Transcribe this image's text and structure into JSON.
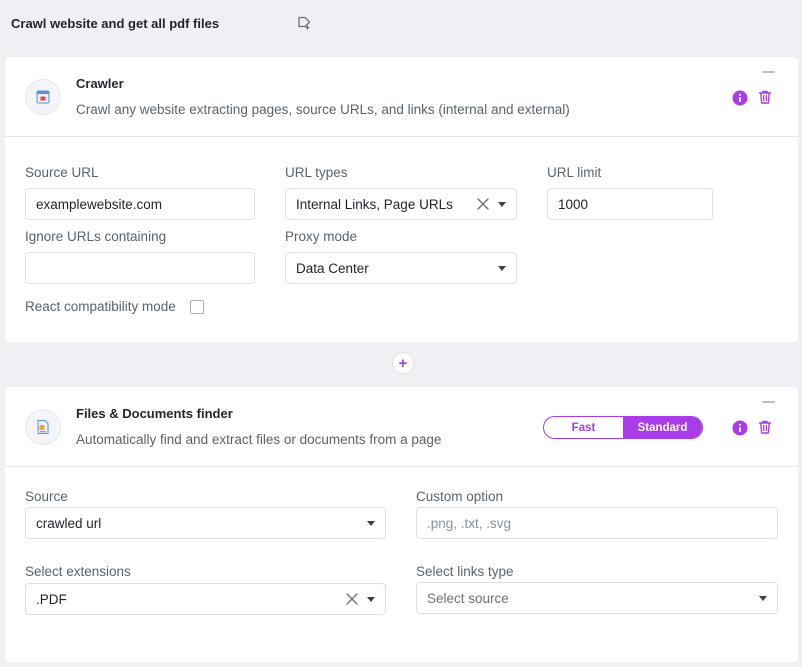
{
  "page": {
    "title": "Crawl website and get all pdf files"
  },
  "colors": {
    "accent": "#a93ce8",
    "background": "#eff0f3"
  },
  "crawler": {
    "title": "Crawler",
    "description": "Crawl any website extracting pages, source URLs, and links (internal and external)",
    "icon": "spider-bug-icon",
    "fields": {
      "source_url_label": "Source URL",
      "source_url_value": "examplewebsite.com",
      "url_types_label": "URL types",
      "url_types_value": "Internal Links, Page URLs",
      "url_limit_label": "URL limit",
      "url_limit_value": "1000",
      "ignore_urls_label": "Ignore URLs containing",
      "ignore_urls_value": "",
      "proxy_mode_label": "Proxy mode",
      "proxy_mode_value": "Data Center",
      "react_mode_label": "React compatibility mode",
      "react_mode_checked": false
    }
  },
  "add_step": {
    "label": "+"
  },
  "finder": {
    "title": "Files & Documents finder",
    "description": "Automatically find and extract files or documents from a page",
    "icon": "document-icon",
    "mode": {
      "fast": "Fast",
      "standard": "Standard",
      "selected": "Standard"
    },
    "fields": {
      "source_label": "Source",
      "source_value": "crawled url",
      "custom_option_label": "Custom option",
      "custom_option_placeholder": ".png, .txt, .svg",
      "extensions_label": "Select extensions",
      "extensions_value": ".PDF",
      "links_type_label": "Select links type",
      "links_type_placeholder": "Select source"
    }
  }
}
